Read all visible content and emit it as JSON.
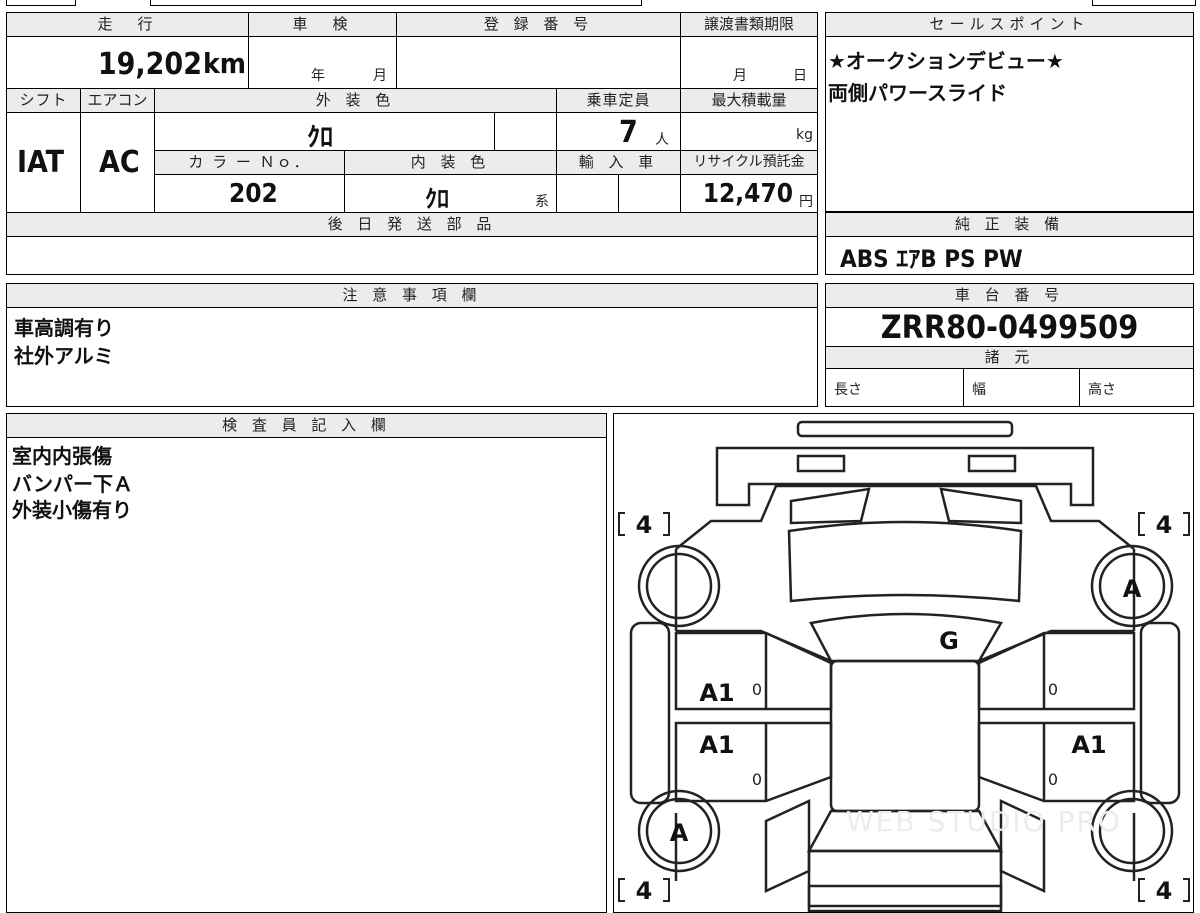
{
  "main_sheet": {
    "mileage": {
      "label": "走　行",
      "value": "19,202",
      "unit": "km"
    },
    "inspection": {
      "label": "車　検",
      "year_label": "年",
      "month_label": "月"
    },
    "registration": {
      "label": "登 録 番 号",
      "value": ""
    },
    "transfer_deadline": {
      "label": "譲渡書類期限",
      "month_label": "月",
      "day_label": "日"
    },
    "shift": {
      "label": "シフト",
      "value": "IAT"
    },
    "aircon": {
      "label": "エアコン",
      "value": "AC"
    },
    "exterior_color": {
      "label": "外 装 色",
      "value": "ｸﾛ"
    },
    "capacity": {
      "label": "乗車定員",
      "value": "7",
      "unit": "人"
    },
    "max_load": {
      "label": "最大積載量",
      "unit": "kg"
    },
    "color_no": {
      "label": "カ ラ ー Ｎｏ．",
      "value": "202"
    },
    "interior_color": {
      "label": "内 装 色",
      "value": "ｸﾛ",
      "suffix": "系"
    },
    "import": {
      "label": "輸 入 車"
    },
    "recycle": {
      "label": "リサイクル預託金",
      "value": "12,470",
      "unit": "円"
    },
    "later_parts": {
      "label": "後 日 発 送 部 品",
      "value": ""
    }
  },
  "sales_points": {
    "label": "セールスポイント",
    "lines": [
      "★オークションデビュー★",
      "両側パワースライド"
    ]
  },
  "equipment": {
    "label": "純 正 装 備",
    "value": "ABS ｴｱB PS PW"
  },
  "notes": {
    "label": "注 意 事 項 欄",
    "lines": [
      "車高調有り",
      "社外アルミ"
    ]
  },
  "chassis": {
    "label": "車 台 番 号",
    "value": "ZRR80-0499509"
  },
  "specs": {
    "label": "諸 元",
    "length_label": "長さ",
    "width_label": "幅",
    "height_label": "高さ"
  },
  "inspector": {
    "label": "検 査 員 記 入 欄",
    "lines": [
      "室内内張傷",
      "バンパー下Ａ",
      "外装小傷有り"
    ]
  },
  "diagram": {
    "tires": {
      "front_left": "4",
      "front_right": "4",
      "rear_left": "4",
      "rear_right": "4"
    },
    "marks": {
      "front_right_wheel": "A",
      "windshield": "G",
      "front_left_door": "A1",
      "rear_left_door": "A1",
      "rear_right_door": "A1",
      "rear_left_wheel": "A",
      "front_left_door_small": "0",
      "rear_left_door_small": "0",
      "front_right_door_small": "0",
      "rear_right_door_small": "0"
    },
    "watermark": "WEB STUDIO PRO"
  }
}
